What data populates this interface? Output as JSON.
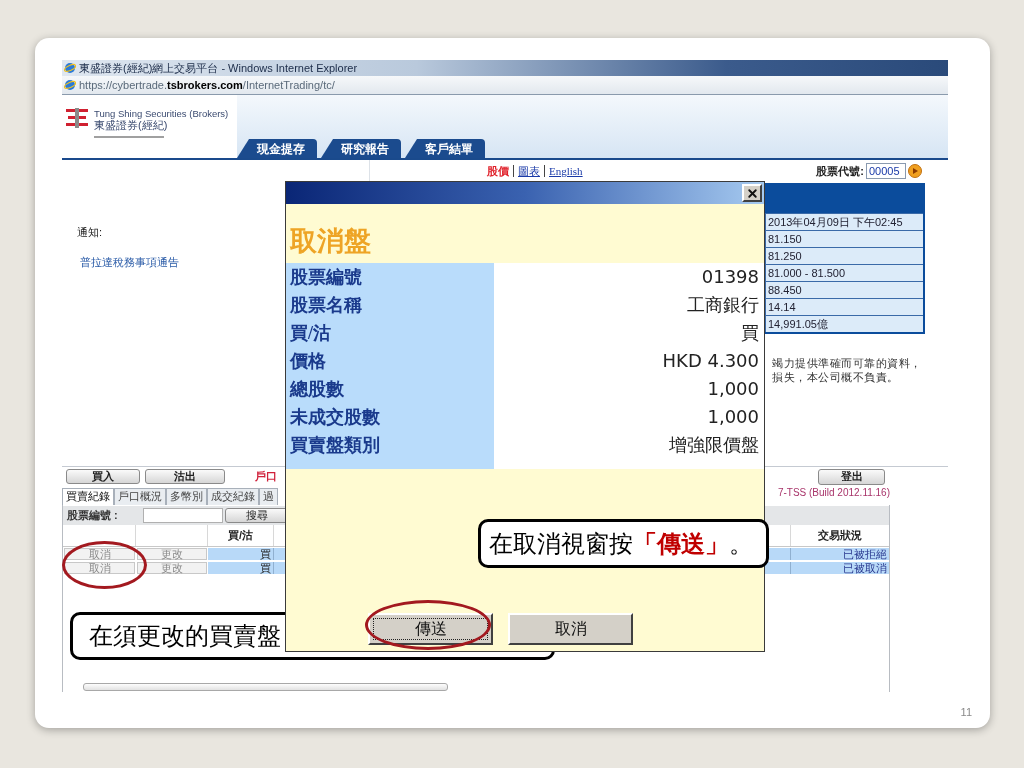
{
  "browser": {
    "title": "東盛證券(經紀)網上交易平台 - Windows Internet Explorer",
    "url": "https://cybertrade.**tsbrokers.com**/InternetTrading/tc/"
  },
  "header": {
    "company_en": "Tung Shing Securities (Brokers)",
    "company_zh": "東盛證券(經紀)",
    "tabs": [
      {
        "label": "現金提存"
      },
      {
        "label": "研究報告"
      },
      {
        "label": "客戶結單"
      }
    ]
  },
  "notice": {
    "label": "通知:",
    "link": "普拉達稅務事項通告"
  },
  "quote_links": [
    {
      "label": "股價",
      "selected": true
    },
    {
      "label": "圖表",
      "selected": false
    },
    {
      "label": "English",
      "selected": false
    }
  ],
  "stock_code": {
    "label": "股票代號:",
    "value": "00005"
  },
  "quote_panel": {
    "values": [
      "2013年04月09日 下午02:45",
      "81.150",
      "81.250",
      "81.000 - 81.500",
      "88.450",
      "14.14",
      "14,991.05億"
    ]
  },
  "disclaimer": [
    "竭力提供準確而可靠的資料，",
    "損失，本公司概不負責。"
  ],
  "order_panel": {
    "buttons": [
      {
        "label": "買入"
      },
      {
        "label": "沽出"
      }
    ],
    "section_title": "戶口",
    "logout": "登出",
    "build": "7-TSS (Build 2012.11.16)",
    "tabs": [
      {
        "label": "買賣紀錄",
        "selected": true
      },
      {
        "label": "戶口概況",
        "selected": false
      },
      {
        "label": "多幣別",
        "selected": false
      },
      {
        "label": "成交紀錄",
        "selected": false
      },
      {
        "label": "過",
        "selected": false
      }
    ],
    "search": {
      "label": "股票編號 :",
      "button": "搜尋"
    },
    "table": {
      "headers": {
        "buy_sell": "買/沽",
        "status": "交易狀況"
      },
      "rows": [
        {
          "cancel": "取消",
          "modify": "更改",
          "buy_sell": "買",
          "status": "已被拒絕"
        },
        {
          "cancel": "取消",
          "modify": "更改",
          "buy_sell": "買",
          "status": "已被取消"
        }
      ]
    }
  },
  "dialog": {
    "title": "取消盤",
    "fields": [
      {
        "label": "股票編號",
        "value": "01398"
      },
      {
        "label": "股票名稱",
        "value": "工商銀行"
      },
      {
        "label": "買/沽",
        "value": "買"
      },
      {
        "label": "價格",
        "value": "HKD 4.300"
      },
      {
        "label": "總股數",
        "value": "1,000"
      },
      {
        "label": "未成交股數",
        "value": "1,000"
      },
      {
        "label": "買賣盤類別",
        "value": "增強限價盤"
      }
    ],
    "buttons": [
      {
        "label": "傳送",
        "focused": true
      },
      {
        "label": "取消",
        "focused": false
      }
    ]
  },
  "callouts": [
    {
      "text": "在取消視窗按**「傳送」**。"
    },
    {
      "text": "在須更改的買賣盤"
    }
  ],
  "page_number": "11"
}
